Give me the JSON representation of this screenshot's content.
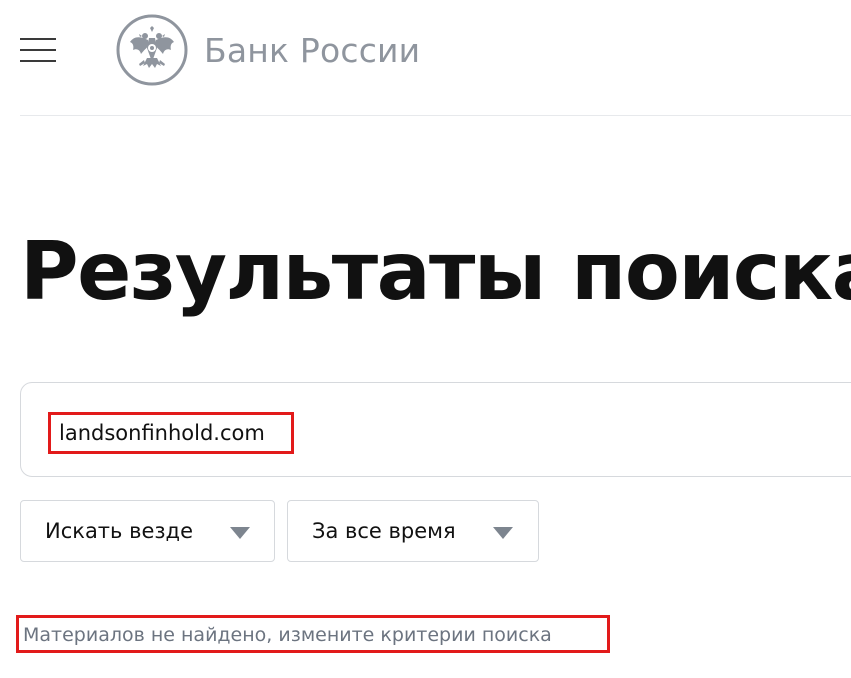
{
  "header": {
    "menu_icon": "hamburger-menu-icon",
    "logo_icon": "double-headed-eagle-icon",
    "logo_text": "Банк России"
  },
  "main": {
    "title": "Результаты поиска",
    "search": {
      "value": "landsonfinhold.com"
    },
    "filters": [
      {
        "label": "Искать везде",
        "icon": "caret-down-icon"
      },
      {
        "label": "За все время",
        "icon": "caret-down-icon"
      }
    ],
    "no_results_message": "Материалов не найдено, измените критерии поиска"
  },
  "colors": {
    "highlight_border": "#e21a1a",
    "logo_gray": "#8f959e",
    "muted_text": "#6c7480",
    "field_border": "#d6d9dd"
  }
}
